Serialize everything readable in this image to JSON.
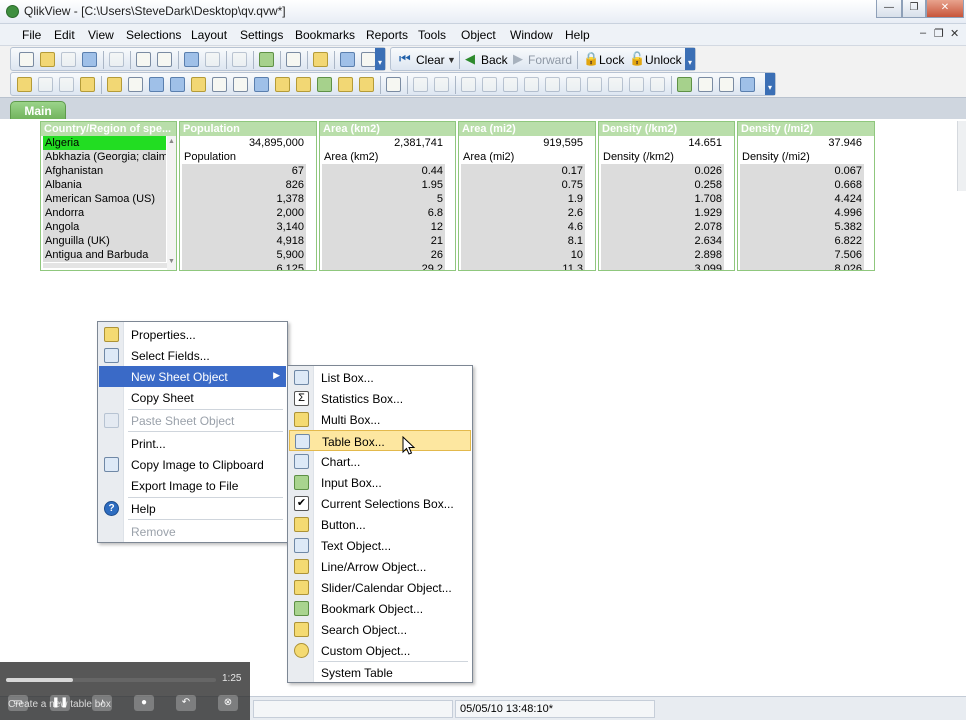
{
  "window": {
    "title": "QlikView - [C:\\Users\\SteveDark\\Desktop\\qv.qvw*]",
    "minimize_glyph": "—",
    "restore_glyph": "❐",
    "close_glyph": "✕"
  },
  "menu": {
    "items": [
      "File",
      "Edit",
      "View",
      "Selections",
      "Layout",
      "Settings",
      "Bookmarks",
      "Reports",
      "Tools",
      "Object",
      "Window",
      "Help"
    ],
    "mdi_min": "–",
    "mdi_restore": "❐",
    "mdi_close": "✕"
  },
  "toolbar": {
    "clear": "Clear",
    "back": "Back",
    "forward": "Forward",
    "lock": "Lock",
    "unlock": "Unlock"
  },
  "sheet": {
    "tab": "Main"
  },
  "listboxes": [
    {
      "caption": "Country/Region of spe...",
      "selected": "Algeria",
      "rows": [
        "Abkhazia (Georgia; claims i",
        "Afghanistan",
        "Albania",
        "American Samoa (US)",
        "Andorra",
        "Angola",
        "Anguilla (UK)",
        "Antigua and Barbuda"
      ]
    },
    {
      "caption": "Population",
      "selected": "34,895,000",
      "header": "Population",
      "rows": [
        "67",
        "826",
        "1,378",
        "2,000",
        "3,140",
        "4,918",
        "5,900",
        "6,125"
      ]
    },
    {
      "caption": "Area (km2)",
      "selected": "2,381,741",
      "header": "Area (km2)",
      "rows": [
        "0.44",
        "1.95",
        "5",
        "6.8",
        "12",
        "21",
        "26",
        "29.2"
      ]
    },
    {
      "caption": "Area (mi2)",
      "selected": "919,595",
      "header": "Area (mi2)",
      "rows": [
        "0.17",
        "0.75",
        "1.9",
        "2.6",
        "4.6",
        "8.1",
        "10",
        "11.3"
      ]
    },
    {
      "caption": "Density (/km2)",
      "selected": "14.651",
      "header": "Density (/km2)",
      "rows": [
        "0.026",
        "0.258",
        "1.708",
        "1.929",
        "2.078",
        "2.634",
        "2.898",
        "3.099"
      ]
    },
    {
      "caption": "Density (/mi2)",
      "selected": "37.946",
      "header": "Density (/mi2)",
      "rows": [
        "0.067",
        "0.668",
        "4.424",
        "4.996",
        "5.382",
        "6.822",
        "7.506",
        "8.026"
      ]
    }
  ],
  "context_menu": {
    "properties": "Properties...",
    "select_fields": "Select Fields...",
    "new_sheet_object": "New Sheet Object",
    "copy_sheet": "Copy Sheet",
    "paste_sheet_object": "Paste Sheet Object",
    "print": "Print...",
    "copy_image": "Copy Image to Clipboard",
    "export_image": "Export Image to File",
    "help": "Help",
    "remove": "Remove"
  },
  "submenu": {
    "list_box": "List Box...",
    "statistics_box": "Statistics Box...",
    "multi_box": "Multi Box...",
    "table_box": "Table Box...",
    "chart": "Chart...",
    "input_box": "Input Box...",
    "current_selections_box": "Current Selections Box...",
    "button": "Button...",
    "text_object": "Text Object...",
    "line_arrow_object": "Line/Arrow Object...",
    "slider_calendar_object": "Slider/Calendar Object...",
    "bookmark_object": "Bookmark Object...",
    "search_object": "Search Object...",
    "custom_object": "Custom Object...",
    "system_table": "System Table"
  },
  "status": {
    "timestamp": "05/05/10 13:48:10*"
  },
  "player": {
    "time": "1:25",
    "caption": "Create a new table box",
    "progress": 0.32
  },
  "colors": {
    "selected": "#22dd22",
    "listbox_caption": "#b9deaa",
    "menu_highlight": "#3a6ac7",
    "submenu_highlight": "#fde7a0"
  }
}
